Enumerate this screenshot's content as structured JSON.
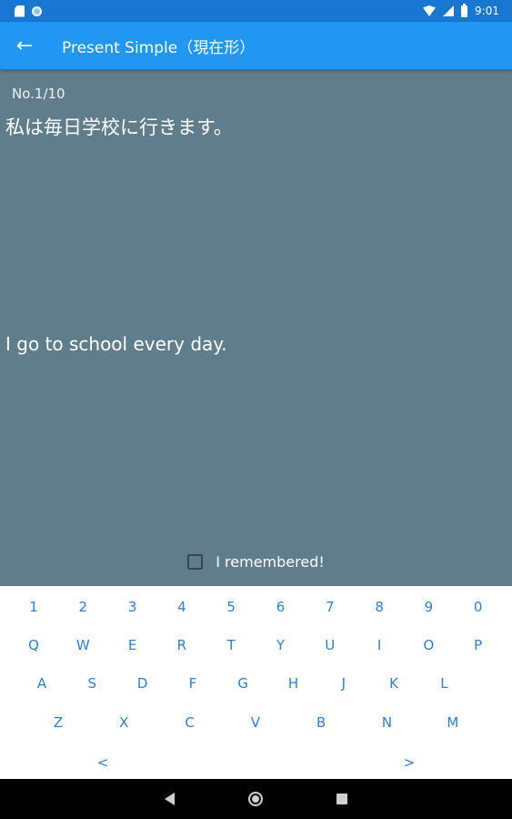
{
  "status_bar": {
    "time": "9:01",
    "color": "#1976d2"
  },
  "app_bar": {
    "title": "Present Simple（現在形）",
    "color": "#2196f3",
    "back_icon": "arrow-back-icon"
  },
  "card": {
    "counter": "No.1/10",
    "question": "私は毎日学校に行きます。",
    "answer": "I go to school every day.",
    "remember_label": "I remembered!",
    "remember_checked": false,
    "background": "#607d8b"
  },
  "keyboard": {
    "key_color": "#2f7fd0",
    "rows": [
      [
        "1",
        "2",
        "3",
        "4",
        "5",
        "6",
        "7",
        "8",
        "9",
        "0"
      ],
      [
        "Q",
        "W",
        "E",
        "R",
        "T",
        "Y",
        "U",
        "I",
        "O",
        "P"
      ],
      [
        "A",
        "S",
        "D",
        "F",
        "G",
        "H",
        "J",
        "K",
        "L"
      ],
      [
        "Z",
        "X",
        "C",
        "V",
        "B",
        "N",
        "M"
      ],
      [
        "<",
        ">"
      ]
    ]
  },
  "nav_bar": {
    "icons": [
      "nav-back-icon",
      "nav-home-icon",
      "nav-recent-icon"
    ]
  }
}
